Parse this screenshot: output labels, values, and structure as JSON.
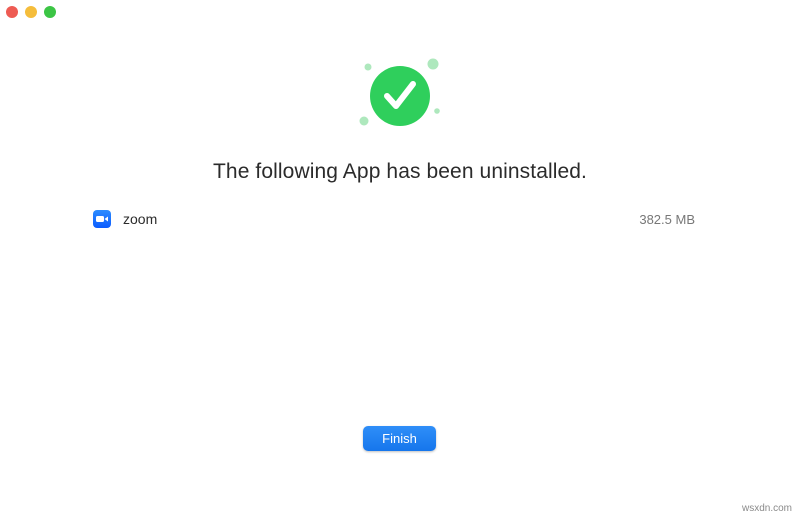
{
  "window": {
    "controls": [
      "close",
      "minimize",
      "zoom"
    ],
    "colors": {
      "close": "#ee5b53",
      "minimize": "#f5bd3b",
      "zoom": "#3cc545"
    }
  },
  "status": {
    "icon": "check-circle-icon",
    "accent_color": "#2fcf5c",
    "message": "The following App has been uninstalled."
  },
  "apps": [
    {
      "icon": "zoom-app-icon",
      "name": "zoom",
      "size": "382.5 MB"
    }
  ],
  "actions": {
    "finish_label": "Finish",
    "button_color": "#1676ec"
  },
  "watermark": "wsxdn.com"
}
